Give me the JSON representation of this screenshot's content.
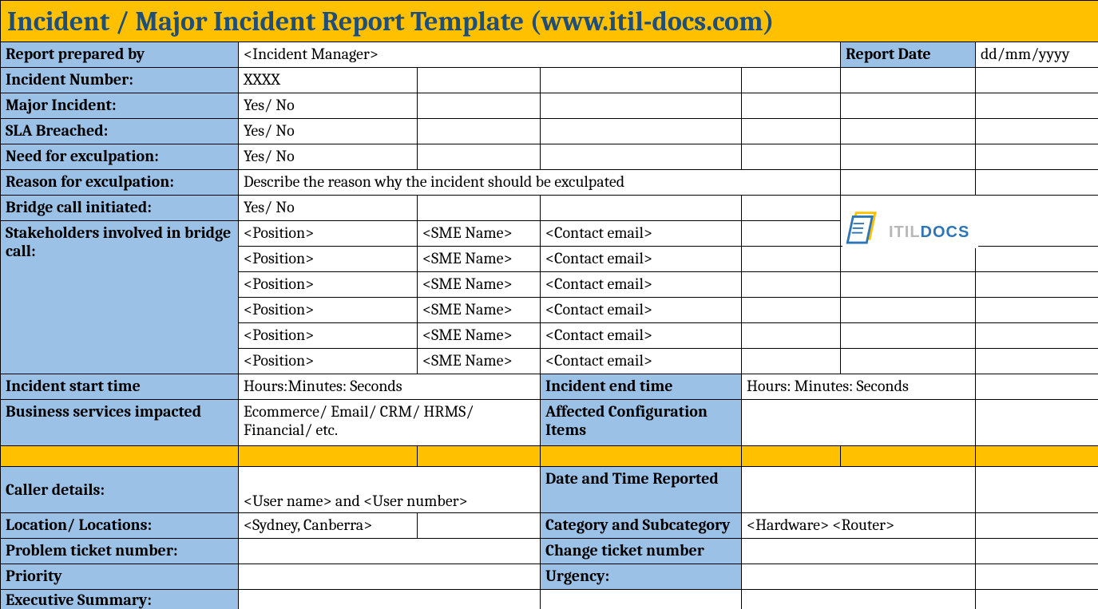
{
  "title": "Incident / Major Incident Report Template   (www.itil-docs.com)",
  "rows": {
    "report_prepared_by_label": "Report prepared by",
    "report_prepared_by_value": "<Incident Manager>",
    "report_date_label": "Report Date",
    "report_date_value": "dd/mm/yyyy",
    "incident_number_label": "Incident Number:",
    "incident_number_value": "XXXX",
    "major_incident_label": "Major Incident:",
    "major_incident_value": "Yes/ No",
    "sla_breached_label": "SLA Breached:",
    "sla_breached_value": "Yes/ No",
    "need_exculpation_label": "Need for exculpation:",
    "need_exculpation_value": "Yes/ No",
    "reason_exculpation_label": "Reason for exculpation:",
    "reason_exculpation_value": "Describe the reason why the incident should be exculpated",
    "bridge_call_label": "Bridge call initiated:",
    "bridge_call_value": "Yes/ No",
    "stakeholders_label": "Stakeholders involved in bridge call:",
    "stakeholders": [
      {
        "position": "<Position>",
        "sme": "<SME Name>",
        "contact": "<Contact email>"
      },
      {
        "position": "<Position>",
        "sme": "<SME Name>",
        "contact": "<Contact email>"
      },
      {
        "position": "<Position>",
        "sme": "<SME Name>",
        "contact": "<Contact email>"
      },
      {
        "position": "<Position>",
        "sme": "<SME Name>",
        "contact": "<Contact email>"
      },
      {
        "position": "<Position>",
        "sme": "<SME Name>",
        "contact": "<Contact email>"
      },
      {
        "position": "<Position>",
        "sme": "<SME Name>",
        "contact": "<Contact email>"
      }
    ],
    "incident_start_label": "Incident start time",
    "incident_start_value": "Hours:Minutes: Seconds",
    "incident_end_label": "Incident end time",
    "incident_end_value": "Hours: Minutes: Seconds",
    "business_services_label": "Business services impacted",
    "business_services_value": "Ecommerce/ Email/ CRM/ HRMS/ Financial/ etc.",
    "affected_ci_label": "Affected Configuration Items",
    "caller_details_label": "Caller details:",
    "caller_details_value": "<User name> and <User number>",
    "date_time_reported_label": "Date and Time Reported",
    "location_label": "Location/ Locations:",
    "location_value": "<Sydney, Canberra>",
    "category_label": "Category and Subcategory",
    "category_value": "<Hardware> <Router>",
    "problem_ticket_label": "Problem ticket number:",
    "change_ticket_label": "Change ticket number",
    "priority_label": "Priority",
    "urgency_label": "Urgency:",
    "executive_summary_label": "Executive Summary:"
  },
  "logo": {
    "itil": "ITIL",
    "docs": "DOCS"
  }
}
